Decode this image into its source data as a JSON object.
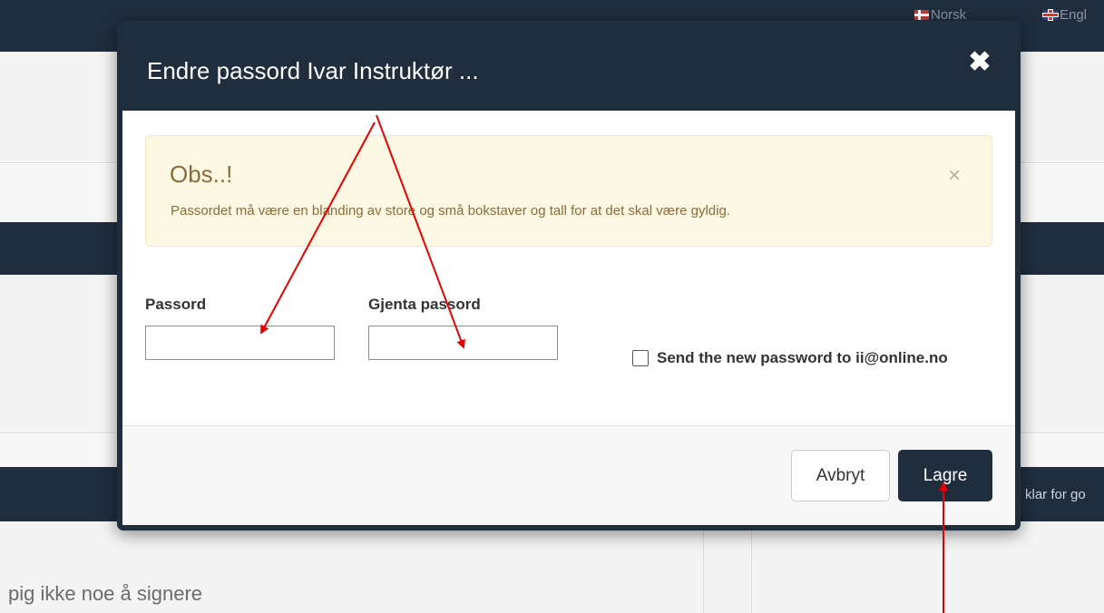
{
  "background": {
    "languages": [
      {
        "label": "Norsk",
        "flag": "flag-norway-icon"
      },
      {
        "label": "Engl",
        "flag": "flag-uk-icon"
      }
    ],
    "status_text": "klar for go",
    "notice_text": "pig ikke noe å signere"
  },
  "modal": {
    "title": "Endre passord Ivar Instruktør ...",
    "close_icon": "close-x-icon",
    "alert": {
      "title": "Obs..!",
      "message": "Passordet må være en blanding av store og små bokstaver og tall for at det skal være gyldig.",
      "close_glyph": "×"
    },
    "fields": {
      "password_label": "Passord",
      "password_value": "",
      "repeat_label": "Gjenta passord",
      "repeat_value": ""
    },
    "send_checkbox": {
      "label": "Send the new password to ii@online.no",
      "checked": false
    },
    "buttons": {
      "cancel": "Avbryt",
      "save": "Lagre"
    }
  },
  "annotations": {
    "arrow_color": "#e60000"
  },
  "colors": {
    "navy": "#1f2d3d",
    "alert_bg": "#fcf8e3",
    "alert_text": "#8a6d3b"
  }
}
